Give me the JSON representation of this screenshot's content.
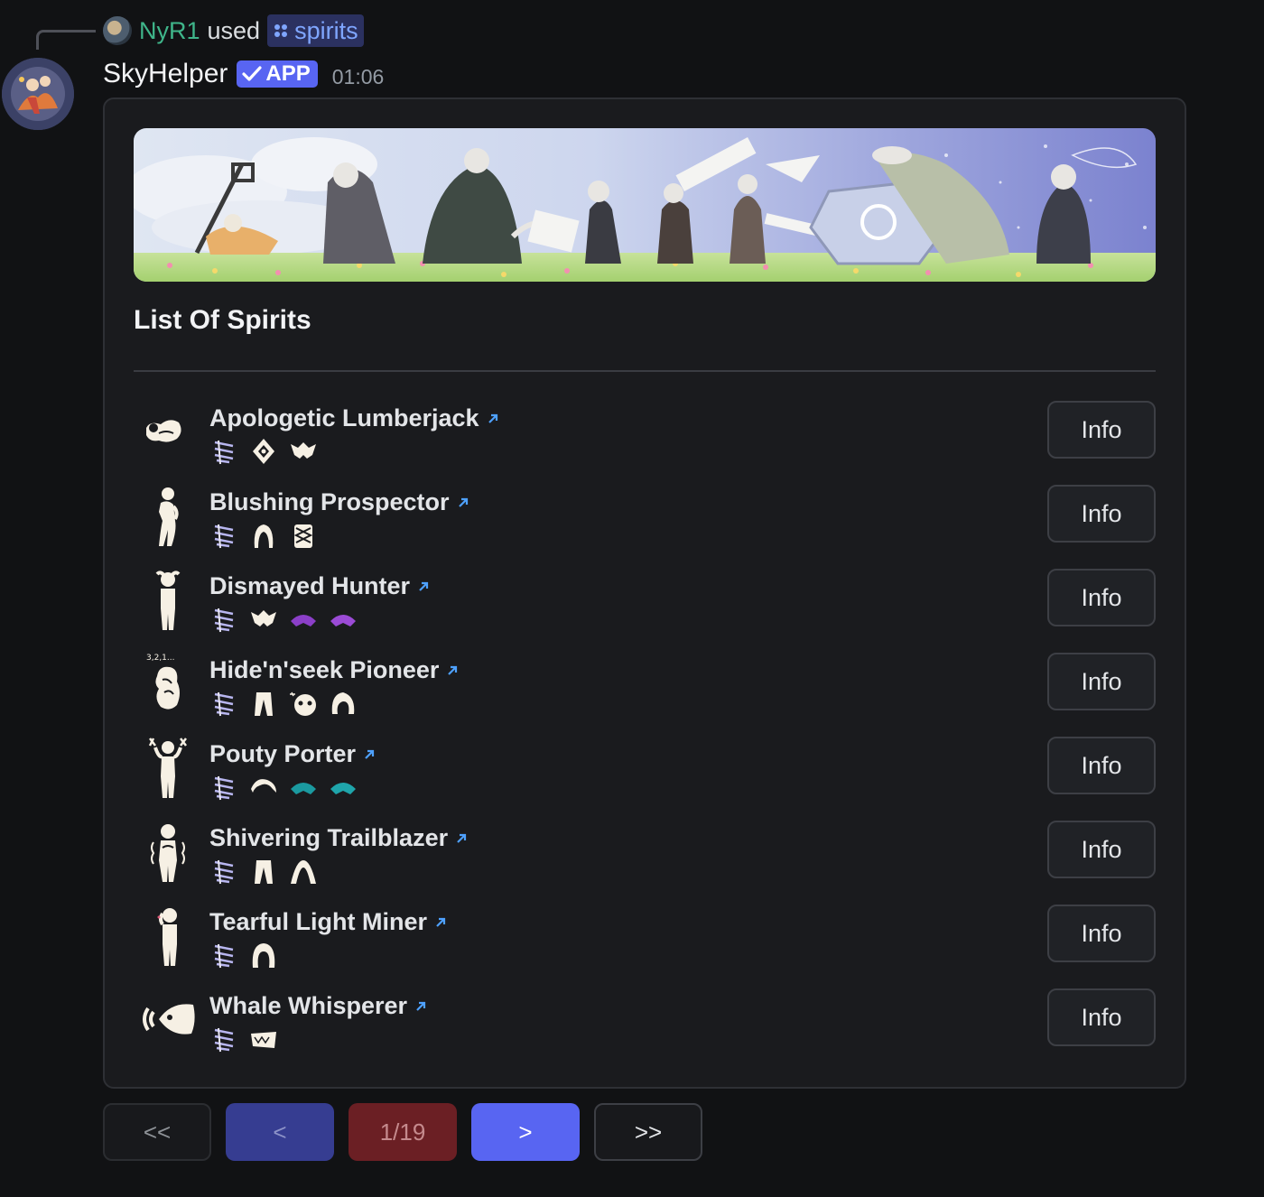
{
  "reply": {
    "username": "NyR1",
    "used_text": "used",
    "command": "spirits"
  },
  "message": {
    "author": "SkyHelper",
    "badge": "APP",
    "timestamp": "01:06"
  },
  "embed": {
    "title": "List Of Spirits",
    "spirits": [
      {
        "name": "Apologetic Lumberjack",
        "button": "Info"
      },
      {
        "name": "Blushing Prospector",
        "button": "Info"
      },
      {
        "name": "Dismayed Hunter",
        "button": "Info"
      },
      {
        "name": "Hide'n'seek Pioneer",
        "button": "Info"
      },
      {
        "name": "Pouty Porter",
        "button": "Info"
      },
      {
        "name": "Shivering Trailblazer",
        "button": "Info"
      },
      {
        "name": "Tearful Light Miner",
        "button": "Info"
      },
      {
        "name": "Whale Whisperer",
        "button": "Info"
      }
    ],
    "hide_seek_caption": "3,2,1..."
  },
  "pagination": {
    "first": "<<",
    "prev": "<",
    "page": "1/19",
    "next": ">",
    "last": ">>"
  },
  "colors": {
    "background": "#111214",
    "card": "#1a1b1e",
    "accent": "#5865f2",
    "username": "#3fb58a",
    "link": "#4ea1ff",
    "page_indicator": "#6b1f24"
  }
}
